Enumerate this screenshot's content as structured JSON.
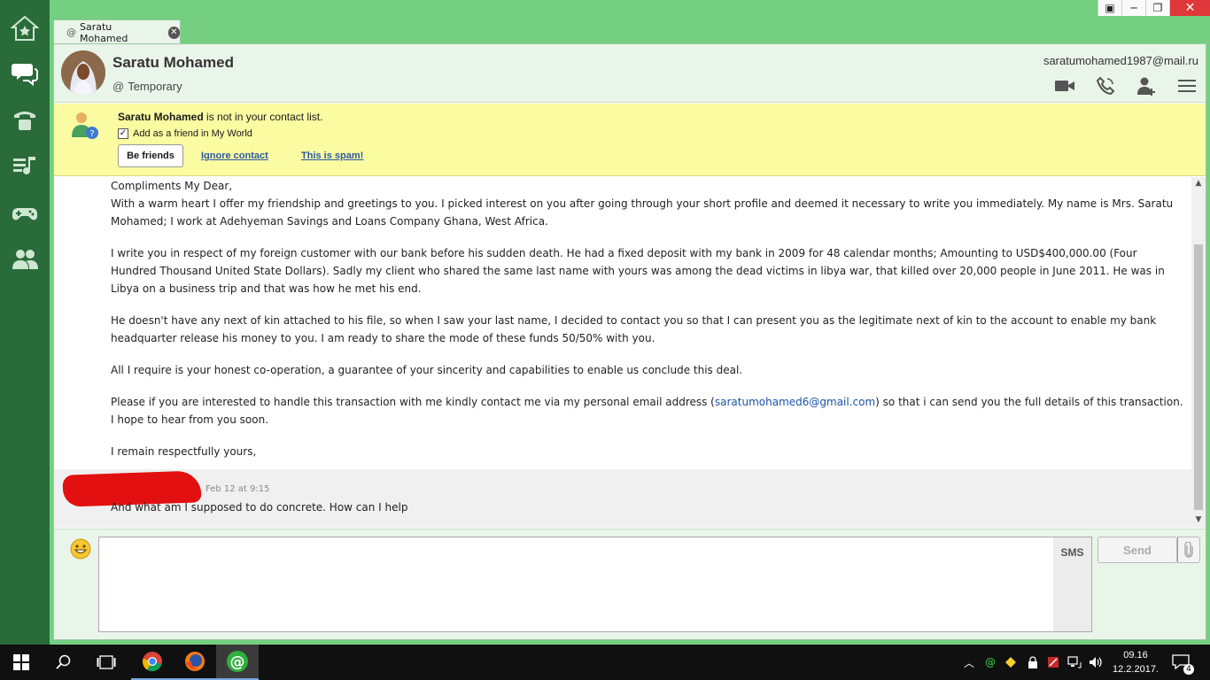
{
  "tab": {
    "label": "Saratu Mohamed",
    "at_icon": "at-icon"
  },
  "header": {
    "name": "Saratu Mohamed",
    "status": "Temporary",
    "email": "saratumohamed1987@mail.ru"
  },
  "notice": {
    "name": "Saratu Mohamed",
    "text": " is not in your contact list.",
    "checkbox_label": "Add as a friend in My World",
    "checkbox_checked": true,
    "be_friends": "Be friends",
    "ignore": "Ignore contact",
    "spam": "This is spam!"
  },
  "messages": {
    "greeting": "Compliments My Dear,",
    "p1": "With a warm heart I offer my friendship and greetings to you. I picked interest on you after going through your short profile and deemed it necessary to write you immediately. My name is Mrs. Saratu Mohamed; I work at Adehyeman Savings and Loans Company Ghana, West Africa.",
    "p2": "I write you in respect of my foreign customer with our bank before his sudden death. He had a fixed deposit with my bank in 2009 for 48 calendar months; Amounting to USD$400,000.00 (Four Hundred Thousand United State Dollars). Sadly my client who shared the same last name with yours was among the dead victims in libya war, that killed over 20,000 people in June 2011. He was in Libya on a business trip and that was how he met his end.",
    "p3": "He doesn't have any next of kin attached to his file, so when I saw your last name, I decided to contact you so that I can present you as the legitimate next of kin to the account to enable my bank headquarter release his money to you. I am ready to share the mode of these funds 50/50% with you.",
    "p4": "All I require is your honest co-operation, a guarantee of your sincerity and capabilities to enable us conclude this deal.",
    "p5_before": "Please if you are interested to handle this transaction with me kindly contact me via my personal email address (",
    "p5_link": "saratumohamed6@gmail.com",
    "p5_after": ") so that i can send you the full details of this transaction. I hope to hear from you soon.",
    "closing": "I remain respectfully yours,",
    "reply_time": "Feb 12 at 9:15",
    "reply_text": "And what am I supposed to do concrete. How can I help"
  },
  "composer": {
    "input_value": "",
    "sms": "SMS",
    "send": "Send"
  },
  "taskbar": {
    "time": "09.16",
    "date": "12.2.2017.",
    "notification_count": "4"
  }
}
